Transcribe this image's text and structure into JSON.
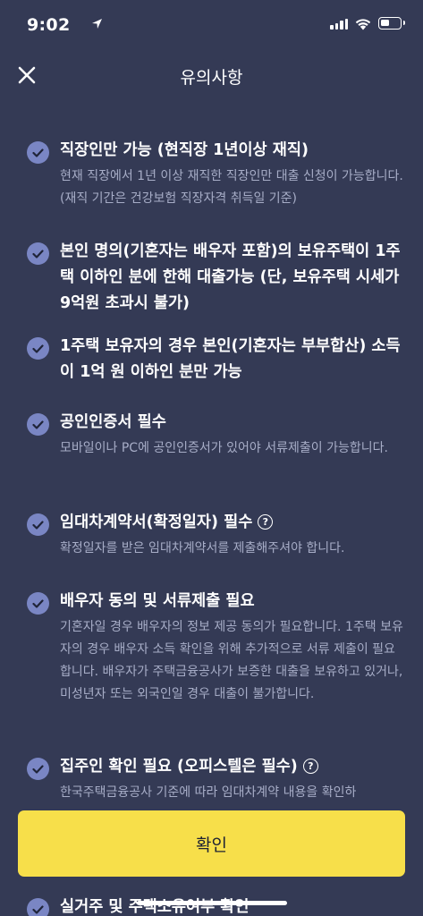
{
  "status_bar": {
    "time": "9:02"
  },
  "header": {
    "title": "유의사항"
  },
  "items": [
    {
      "title": "직장인만 가능 (현직장 1년이상 재직)",
      "desc": "현재 직장에서 1년 이상 재직한 직장인만 대출 신청이 가능합니다. (재직 기간은 건강보험 직장자격 취득일 기준)"
    },
    {
      "title": "본인 명의(기혼자는 배우자 포함)의 보유주택이 1주택 이하인 분에 한해 대출가능 (단, 보유주택 시세가 9억원 초과시 불가)",
      "desc": ""
    },
    {
      "title": "1주택 보유자의 경우 본인(기혼자는 부부합산) 소득이 1억 원 이하인 분만 가능",
      "desc": ""
    },
    {
      "title": "공인인증서 필수",
      "desc": "모바일이나 PC에 공인인증서가 있어야 서류제출이 가능합니다."
    },
    {
      "title": "임대차계약서(확정일자) 필수",
      "desc": "확정일자를 받은 임대차계약서를 제출해주셔야 합니다."
    },
    {
      "title": "배우자 동의 및 서류제출 필요",
      "desc": "기혼자일 경우 배우자의 정보 제공 동의가 필요합니다. 1주택 보유자의 경우 배우자 소득 확인을 위해 추가적으로 서류 제출이 필요합니다. 배우자가 주택금융공사가 보증한 대출을 보유하고 있거나, 미성년자 또는 외국인일 경우 대출이 불가합니다."
    },
    {
      "title": "집주인 확인 필요 (오피스텔은 필수)",
      "desc": "한국주택금융공사 기준에 따라 임대차계약 내용을 확인하"
    },
    {
      "title": "실거주 및 주택소유여부 확인",
      "desc": ""
    }
  ],
  "help_symbol": "?",
  "confirm_label": "확인"
}
